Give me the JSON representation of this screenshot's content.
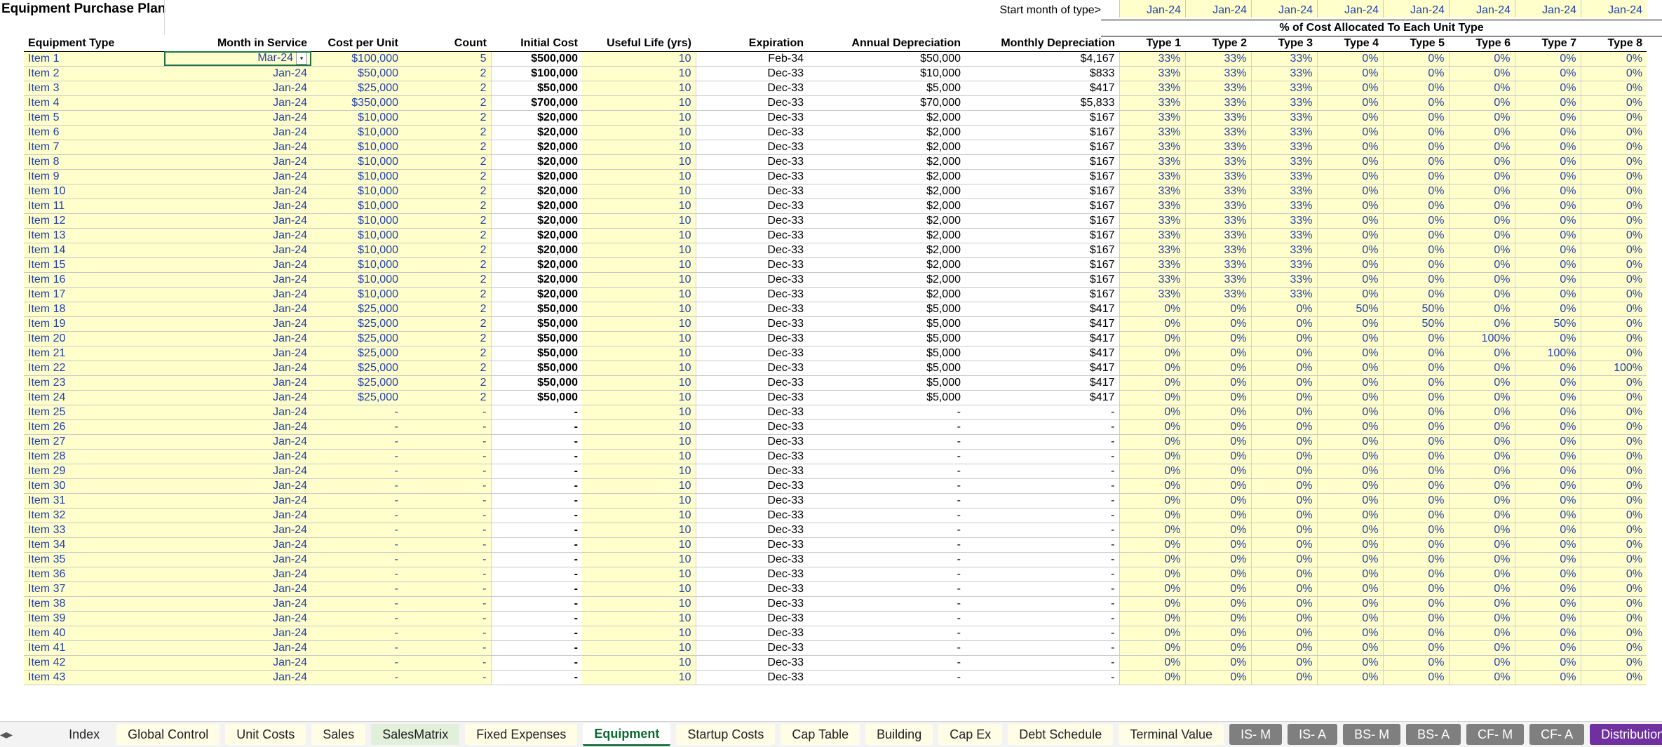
{
  "sheet": {
    "title": "Equipment Purchase Plan",
    "start_label": "Start month of type>",
    "start_months": [
      "Jan-24",
      "Jan-24",
      "Jan-24",
      "Jan-24",
      "Jan-24",
      "Jan-24",
      "Jan-24",
      "Jan-24"
    ],
    "allocation_header": "% of Cost Allocated To Each Unit Type",
    "headers": [
      "Equipment Type",
      "Month in Service",
      "Cost per Unit",
      "Count",
      "Initial Cost",
      "Useful Life (yrs)",
      "Expiration",
      "Annual Depreciation",
      "Monthly Depreciation",
      "Type 1",
      "Type 2",
      "Type 3",
      "Type 4",
      "Type 5",
      "Type 6",
      "Type 7",
      "Type 8"
    ],
    "rows": [
      [
        "Item 1",
        "Mar-24",
        "$100,000",
        "5",
        "$500,000",
        "10",
        "Feb-34",
        "$50,000",
        "$4,167",
        "33%",
        "33%",
        "33%",
        "0%",
        "0%",
        "0%",
        "0%",
        "0%"
      ],
      [
        "Item 2",
        "Jan-24",
        "$50,000",
        "2",
        "$100,000",
        "10",
        "Dec-33",
        "$10,000",
        "$833",
        "33%",
        "33%",
        "33%",
        "0%",
        "0%",
        "0%",
        "0%",
        "0%"
      ],
      [
        "Item 3",
        "Jan-24",
        "$25,000",
        "2",
        "$50,000",
        "10",
        "Dec-33",
        "$5,000",
        "$417",
        "33%",
        "33%",
        "33%",
        "0%",
        "0%",
        "0%",
        "0%",
        "0%"
      ],
      [
        "Item 4",
        "Jan-24",
        "$350,000",
        "2",
        "$700,000",
        "10",
        "Dec-33",
        "$70,000",
        "$5,833",
        "33%",
        "33%",
        "33%",
        "0%",
        "0%",
        "0%",
        "0%",
        "0%"
      ],
      [
        "Item 5",
        "Jan-24",
        "$10,000",
        "2",
        "$20,000",
        "10",
        "Dec-33",
        "$2,000",
        "$167",
        "33%",
        "33%",
        "33%",
        "0%",
        "0%",
        "0%",
        "0%",
        "0%"
      ],
      [
        "Item 6",
        "Jan-24",
        "$10,000",
        "2",
        "$20,000",
        "10",
        "Dec-33",
        "$2,000",
        "$167",
        "33%",
        "33%",
        "33%",
        "0%",
        "0%",
        "0%",
        "0%",
        "0%"
      ],
      [
        "Item 7",
        "Jan-24",
        "$10,000",
        "2",
        "$20,000",
        "10",
        "Dec-33",
        "$2,000",
        "$167",
        "33%",
        "33%",
        "33%",
        "0%",
        "0%",
        "0%",
        "0%",
        "0%"
      ],
      [
        "Item 8",
        "Jan-24",
        "$10,000",
        "2",
        "$20,000",
        "10",
        "Dec-33",
        "$2,000",
        "$167",
        "33%",
        "33%",
        "33%",
        "0%",
        "0%",
        "0%",
        "0%",
        "0%"
      ],
      [
        "Item 9",
        "Jan-24",
        "$10,000",
        "2",
        "$20,000",
        "10",
        "Dec-33",
        "$2,000",
        "$167",
        "33%",
        "33%",
        "33%",
        "0%",
        "0%",
        "0%",
        "0%",
        "0%"
      ],
      [
        "Item 10",
        "Jan-24",
        "$10,000",
        "2",
        "$20,000",
        "10",
        "Dec-33",
        "$2,000",
        "$167",
        "33%",
        "33%",
        "33%",
        "0%",
        "0%",
        "0%",
        "0%",
        "0%"
      ],
      [
        "Item 11",
        "Jan-24",
        "$10,000",
        "2",
        "$20,000",
        "10",
        "Dec-33",
        "$2,000",
        "$167",
        "33%",
        "33%",
        "33%",
        "0%",
        "0%",
        "0%",
        "0%",
        "0%"
      ],
      [
        "Item 12",
        "Jan-24",
        "$10,000",
        "2",
        "$20,000",
        "10",
        "Dec-33",
        "$2,000",
        "$167",
        "33%",
        "33%",
        "33%",
        "0%",
        "0%",
        "0%",
        "0%",
        "0%"
      ],
      [
        "Item 13",
        "Jan-24",
        "$10,000",
        "2",
        "$20,000",
        "10",
        "Dec-33",
        "$2,000",
        "$167",
        "33%",
        "33%",
        "33%",
        "0%",
        "0%",
        "0%",
        "0%",
        "0%"
      ],
      [
        "Item 14",
        "Jan-24",
        "$10,000",
        "2",
        "$20,000",
        "10",
        "Dec-33",
        "$2,000",
        "$167",
        "33%",
        "33%",
        "33%",
        "0%",
        "0%",
        "0%",
        "0%",
        "0%"
      ],
      [
        "Item 15",
        "Jan-24",
        "$10,000",
        "2",
        "$20,000",
        "10",
        "Dec-33",
        "$2,000",
        "$167",
        "33%",
        "33%",
        "33%",
        "0%",
        "0%",
        "0%",
        "0%",
        "0%"
      ],
      [
        "Item 16",
        "Jan-24",
        "$10,000",
        "2",
        "$20,000",
        "10",
        "Dec-33",
        "$2,000",
        "$167",
        "33%",
        "33%",
        "33%",
        "0%",
        "0%",
        "0%",
        "0%",
        "0%"
      ],
      [
        "Item 17",
        "Jan-24",
        "$10,000",
        "2",
        "$20,000",
        "10",
        "Dec-33",
        "$2,000",
        "$167",
        "33%",
        "33%",
        "33%",
        "0%",
        "0%",
        "0%",
        "0%",
        "0%"
      ],
      [
        "Item 18",
        "Jan-24",
        "$25,000",
        "2",
        "$50,000",
        "10",
        "Dec-33",
        "$5,000",
        "$417",
        "0%",
        "0%",
        "0%",
        "50%",
        "50%",
        "0%",
        "0%",
        "0%"
      ],
      [
        "Item 19",
        "Jan-24",
        "$25,000",
        "2",
        "$50,000",
        "10",
        "Dec-33",
        "$5,000",
        "$417",
        "0%",
        "0%",
        "0%",
        "0%",
        "50%",
        "0%",
        "50%",
        "0%"
      ],
      [
        "Item 20",
        "Jan-24",
        "$25,000",
        "2",
        "$50,000",
        "10",
        "Dec-33",
        "$5,000",
        "$417",
        "0%",
        "0%",
        "0%",
        "0%",
        "0%",
        "100%",
        "0%",
        "0%"
      ],
      [
        "Item 21",
        "Jan-24",
        "$25,000",
        "2",
        "$50,000",
        "10",
        "Dec-33",
        "$5,000",
        "$417",
        "0%",
        "0%",
        "0%",
        "0%",
        "0%",
        "0%",
        "100%",
        "0%"
      ],
      [
        "Item 22",
        "Jan-24",
        "$25,000",
        "2",
        "$50,000",
        "10",
        "Dec-33",
        "$5,000",
        "$417",
        "0%",
        "0%",
        "0%",
        "0%",
        "0%",
        "0%",
        "0%",
        "100%"
      ],
      [
        "Item 23",
        "Jan-24",
        "$25,000",
        "2",
        "$50,000",
        "10",
        "Dec-33",
        "$5,000",
        "$417",
        "0%",
        "0%",
        "0%",
        "0%",
        "0%",
        "0%",
        "0%",
        "0%"
      ],
      [
        "Item 24",
        "Jan-24",
        "$25,000",
        "2",
        "$50,000",
        "10",
        "Dec-33",
        "$5,000",
        "$417",
        "0%",
        "0%",
        "0%",
        "0%",
        "0%",
        "0%",
        "0%",
        "0%"
      ],
      [
        "Item 25",
        "Jan-24",
        "-",
        "-",
        "-",
        "10",
        "Dec-33",
        "-",
        "-",
        "0%",
        "0%",
        "0%",
        "0%",
        "0%",
        "0%",
        "0%",
        "0%"
      ],
      [
        "Item 26",
        "Jan-24",
        "-",
        "-",
        "-",
        "10",
        "Dec-33",
        "-",
        "-",
        "0%",
        "0%",
        "0%",
        "0%",
        "0%",
        "0%",
        "0%",
        "0%"
      ],
      [
        "Item 27",
        "Jan-24",
        "-",
        "-",
        "-",
        "10",
        "Dec-33",
        "-",
        "-",
        "0%",
        "0%",
        "0%",
        "0%",
        "0%",
        "0%",
        "0%",
        "0%"
      ],
      [
        "Item 28",
        "Jan-24",
        "-",
        "-",
        "-",
        "10",
        "Dec-33",
        "-",
        "-",
        "0%",
        "0%",
        "0%",
        "0%",
        "0%",
        "0%",
        "0%",
        "0%"
      ],
      [
        "Item 29",
        "Jan-24",
        "-",
        "-",
        "-",
        "10",
        "Dec-33",
        "-",
        "-",
        "0%",
        "0%",
        "0%",
        "0%",
        "0%",
        "0%",
        "0%",
        "0%"
      ],
      [
        "Item 30",
        "Jan-24",
        "-",
        "-",
        "-",
        "10",
        "Dec-33",
        "-",
        "-",
        "0%",
        "0%",
        "0%",
        "0%",
        "0%",
        "0%",
        "0%",
        "0%"
      ],
      [
        "Item 31",
        "Jan-24",
        "-",
        "-",
        "-",
        "10",
        "Dec-33",
        "-",
        "-",
        "0%",
        "0%",
        "0%",
        "0%",
        "0%",
        "0%",
        "0%",
        "0%"
      ],
      [
        "Item 32",
        "Jan-24",
        "-",
        "-",
        "-",
        "10",
        "Dec-33",
        "-",
        "-",
        "0%",
        "0%",
        "0%",
        "0%",
        "0%",
        "0%",
        "0%",
        "0%"
      ],
      [
        "Item 33",
        "Jan-24",
        "-",
        "-",
        "-",
        "10",
        "Dec-33",
        "-",
        "-",
        "0%",
        "0%",
        "0%",
        "0%",
        "0%",
        "0%",
        "0%",
        "0%"
      ],
      [
        "Item 34",
        "Jan-24",
        "-",
        "-",
        "-",
        "10",
        "Dec-33",
        "-",
        "-",
        "0%",
        "0%",
        "0%",
        "0%",
        "0%",
        "0%",
        "0%",
        "0%"
      ],
      [
        "Item 35",
        "Jan-24",
        "-",
        "-",
        "-",
        "10",
        "Dec-33",
        "-",
        "-",
        "0%",
        "0%",
        "0%",
        "0%",
        "0%",
        "0%",
        "0%",
        "0%"
      ],
      [
        "Item 36",
        "Jan-24",
        "-",
        "-",
        "-",
        "10",
        "Dec-33",
        "-",
        "-",
        "0%",
        "0%",
        "0%",
        "0%",
        "0%",
        "0%",
        "0%",
        "0%"
      ],
      [
        "Item 37",
        "Jan-24",
        "-",
        "-",
        "-",
        "10",
        "Dec-33",
        "-",
        "-",
        "0%",
        "0%",
        "0%",
        "0%",
        "0%",
        "0%",
        "0%",
        "0%"
      ],
      [
        "Item 38",
        "Jan-24",
        "-",
        "-",
        "-",
        "10",
        "Dec-33",
        "-",
        "-",
        "0%",
        "0%",
        "0%",
        "0%",
        "0%",
        "0%",
        "0%",
        "0%"
      ],
      [
        "Item 39",
        "Jan-24",
        "-",
        "-",
        "-",
        "10",
        "Dec-33",
        "-",
        "-",
        "0%",
        "0%",
        "0%",
        "0%",
        "0%",
        "0%",
        "0%",
        "0%"
      ],
      [
        "Item 40",
        "Jan-24",
        "-",
        "-",
        "-",
        "10",
        "Dec-33",
        "-",
        "-",
        "0%",
        "0%",
        "0%",
        "0%",
        "0%",
        "0%",
        "0%",
        "0%"
      ],
      [
        "Item 41",
        "Jan-24",
        "-",
        "-",
        "-",
        "10",
        "Dec-33",
        "-",
        "-",
        "0%",
        "0%",
        "0%",
        "0%",
        "0%",
        "0%",
        "0%",
        "0%"
      ],
      [
        "Item 42",
        "Jan-24",
        "-",
        "-",
        "-",
        "10",
        "Dec-33",
        "-",
        "-",
        "0%",
        "0%",
        "0%",
        "0%",
        "0%",
        "0%",
        "0%",
        "0%"
      ],
      [
        "Item 43",
        "Jan-24",
        "-",
        "-",
        "-",
        "10",
        "Dec-33",
        "-",
        "-",
        "0%",
        "0%",
        "0%",
        "0%",
        "0%",
        "0%",
        "0%",
        "0%"
      ]
    ]
  },
  "tabs": [
    {
      "label": "Index",
      "style": "plain"
    },
    {
      "label": "Global Control",
      "style": "yellow"
    },
    {
      "label": "Unit Costs",
      "style": "yellow"
    },
    {
      "label": "Sales",
      "style": "yellow"
    },
    {
      "label": "SalesMatrix",
      "style": "green"
    },
    {
      "label": "Fixed Expenses",
      "style": "yellow"
    },
    {
      "label": "Equipment",
      "style": "active"
    },
    {
      "label": "Startup Costs",
      "style": "yellow"
    },
    {
      "label": "Cap Table",
      "style": "yellow"
    },
    {
      "label": "Building",
      "style": "yellow"
    },
    {
      "label": "Cap Ex",
      "style": "yellow"
    },
    {
      "label": "Debt Schedule",
      "style": "yellow"
    },
    {
      "label": "Terminal Value",
      "style": "yellow"
    },
    {
      "label": "IS- M",
      "style": "gray"
    },
    {
      "label": "IS- A",
      "style": "gray"
    },
    {
      "label": "BS- M",
      "style": "gray"
    },
    {
      "label": "BS- A",
      "style": "gray"
    },
    {
      "label": "CF- M",
      "style": "gray"
    },
    {
      "label": "CF- A",
      "style": "gray"
    },
    {
      "label": "Distributions",
      "style": "purple"
    }
  ],
  "icons": {
    "prev": "◂",
    "next": "▸",
    "more": "⋯",
    "add": "+",
    "options": "⋮",
    "zoom": "—"
  },
  "colors": {
    "input_fill": "#ffffcc",
    "input_text": "#1f3fb0",
    "active_tab": "#217346",
    "gray_tab": "#7f7f7f",
    "purple_tab": "#7030a0"
  }
}
